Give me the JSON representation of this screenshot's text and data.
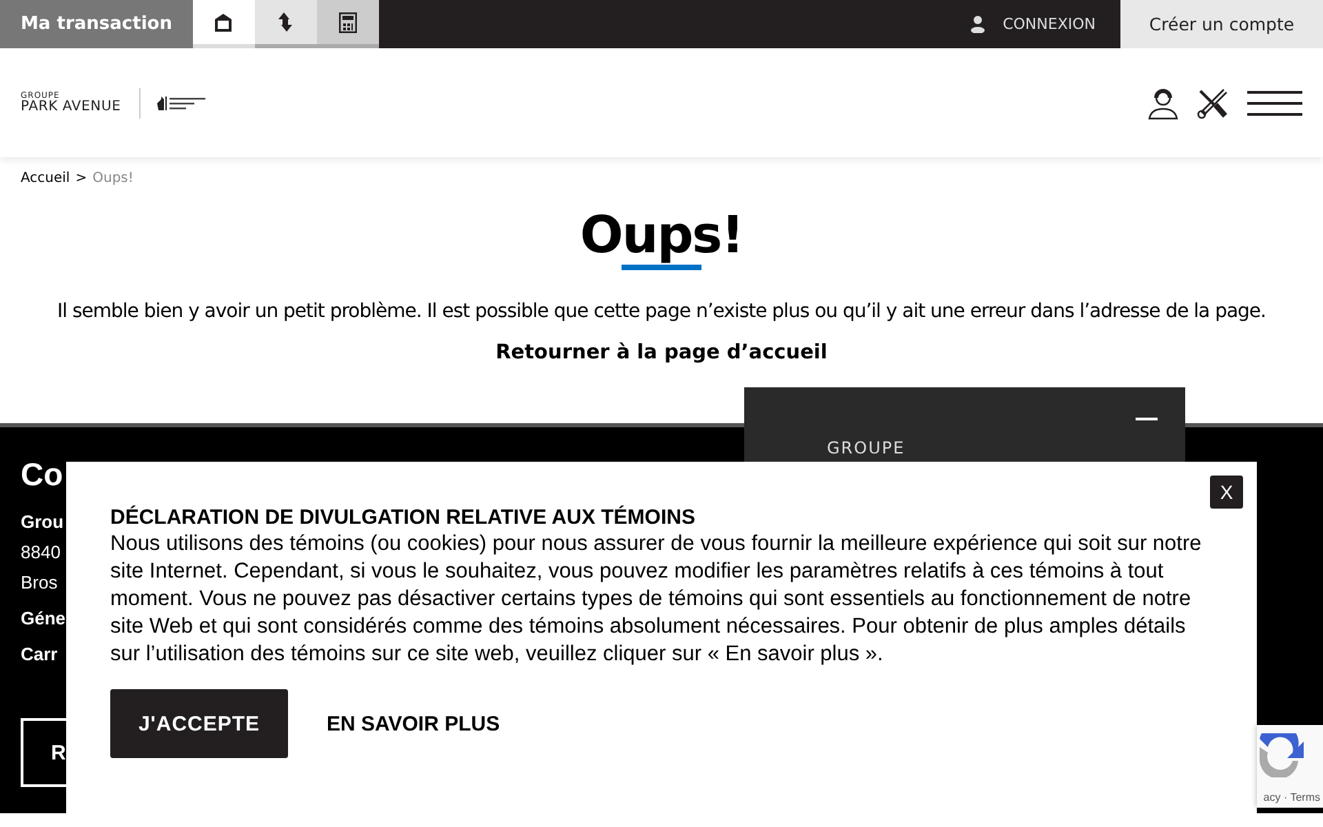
{
  "top_bar": {
    "brand": "Ma transaction",
    "tabs": [
      {
        "kind": "home",
        "selected": true
      },
      {
        "kind": "transfer",
        "selected": false
      },
      {
        "kind": "calculator",
        "selected": false
      }
    ],
    "login": "CONNEXION",
    "create_account": "Créer un compte"
  },
  "header": {
    "logo_small": "GROUPE",
    "logo_name": "PARK AVENUE"
  },
  "breadcrumb": {
    "items": [
      {
        "label": "Accueil",
        "current": false
      },
      {
        "label": "Oups!",
        "current": true
      }
    ],
    "separator": ">"
  },
  "error": {
    "title": "Oups!",
    "message": "Il semble bien y avoir un petit problème. Il est possible que cette page n’existe plus ou qu’il y ait une erreur dans l’adresse de la page.",
    "link": "Retourner à la page d’accueil"
  },
  "footer": {
    "heading": "Co",
    "lines": [
      {
        "text": "Grou",
        "bold": true
      },
      {
        "text": "8840",
        "bold": false
      },
      {
        "text": "Bros",
        "bold": false
      },
      {
        "text": "Géne",
        "bold": true
      },
      {
        "text": "Carr",
        "bold": true
      }
    ],
    "button": "R"
  },
  "chat_widget": {
    "logo": "GROUPE"
  },
  "cookie_notice": {
    "title": "DÉCLARATION DE DIVULGATION RELATIVE AUX TÉMOINS",
    "body": "Nous utilisons des témoins (ou cookies) pour nous assurer de vous fournir la meilleure expérience qui soit sur notre site Internet. Cependant, si vous le souhaitez, vous pouvez modifier les paramètres relatifs à ces témoins à tout moment. Vous ne pouvez pas désactiver certains types de témoins qui sont essentiels au fonctionnement de notre site Web et qui sont considérés comme des témoins absolument nécessaires. Pour obtenir de plus amples détails sur l’utilisation des témoins sur ce site web, veuillez cliquer sur « En savoir plus ».",
    "accept": "J'ACCEPTE",
    "more": "EN SAVOIR PLUS",
    "close": "X"
  },
  "recaptcha": {
    "links": "acy · Terms"
  }
}
